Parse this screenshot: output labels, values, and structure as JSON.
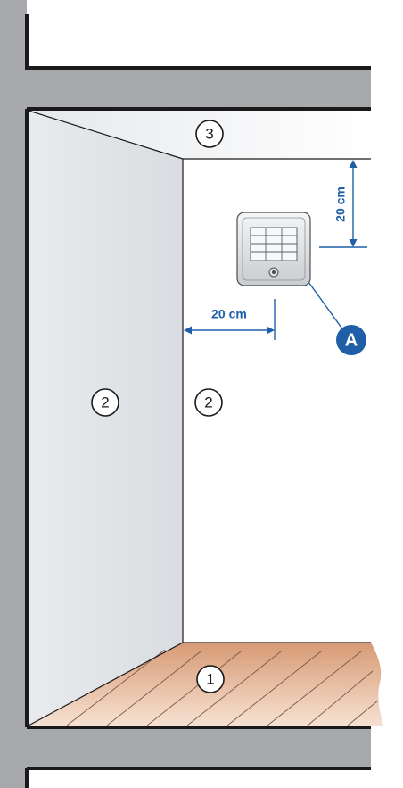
{
  "labels": {
    "floor": "1",
    "wall_side": "2",
    "wall_back": "2",
    "ceiling": "3",
    "device": "A"
  },
  "dimensions": {
    "from_ceiling": "20 cm",
    "from_side_wall": "20 cm"
  },
  "colors": {
    "structure": "#a7a9ac",
    "outline": "#1a1a1a",
    "accent_blue": "#1f5fa8",
    "floor_wood": "#e3b592",
    "wall_gray": "#dcdfe3"
  }
}
